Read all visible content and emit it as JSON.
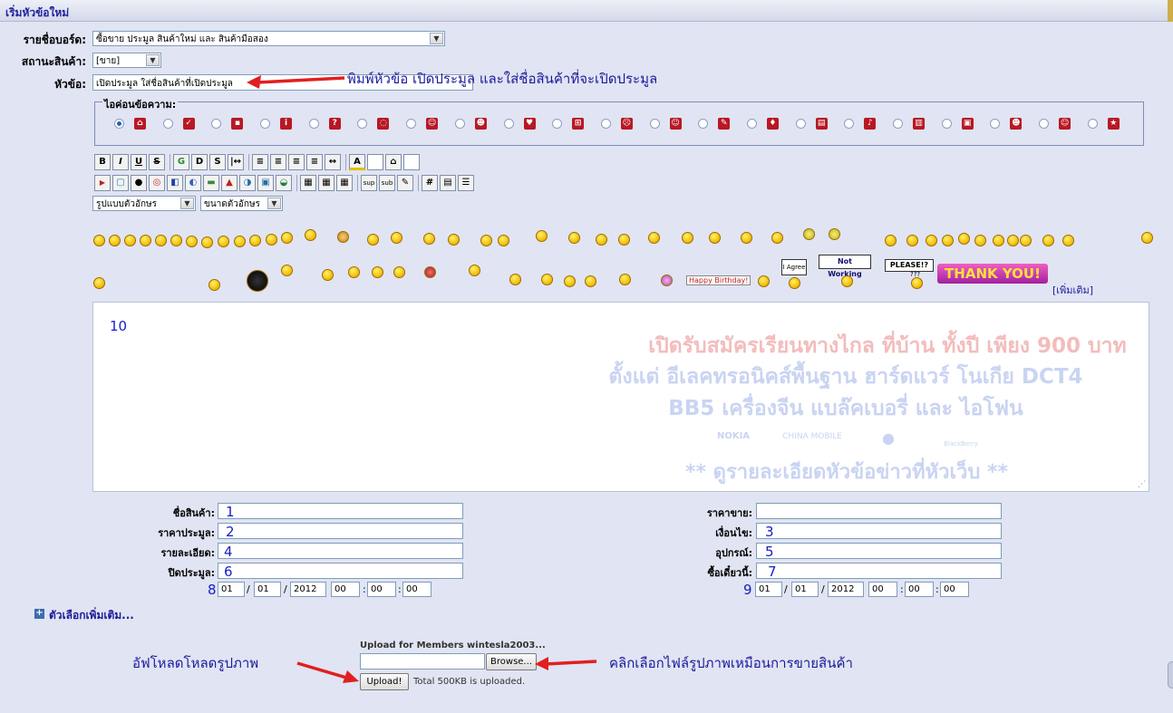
{
  "page": {
    "title": "เริ่มหัวข้อใหม่"
  },
  "form": {
    "board_label": "รายชื่อบอร์ด:",
    "board_value": "ซื้อขาย ประมูล สินค้าใหม่ และ สินค้ามือสอง",
    "status_label": "สถานะสินค้า:",
    "status_value": "[ขาย]",
    "subject_label": "หัวข้อ:",
    "subject_value": "เปิดประมูล ใส่ชื่อสินค้าที่เปิดประมูล",
    "icon_legend": "ไอค่อนข้อความ:",
    "font_select": "รูปแบบตัวอักษร",
    "size_select": "ขนาดตัวอักษร",
    "more_smileys": "[เพิ่มเติม]"
  },
  "annotations": {
    "subject_note": "พิมพ์หัวข้อ เปิดประมูล และใส่ชื่อสินค้าที่จะเปิดประมูล",
    "upload_note": "อัฟโหลดโหลดรูปภาพ",
    "browse_note": "คลิกเลือกไฟล์รูปภาพเหมือนการขายสินค้า"
  },
  "toolbar": {
    "row1": [
      "B",
      "I",
      "U",
      "S",
      "G",
      "D",
      "S",
      "|↔",
      "≡",
      "≡",
      "≡",
      "≡",
      "↔",
      "A",
      "",
      "⌂",
      ""
    ],
    "row2": [
      "▶",
      "▢",
      "●",
      "◎",
      "◧",
      "◐",
      "▬",
      "▲",
      "◑",
      "▣",
      "◒",
      "▦",
      "▦",
      "▦",
      "sup",
      "sub",
      "✎",
      "#",
      "▤",
      "☰"
    ]
  },
  "editor": {
    "content": "10",
    "promo_line1": "เปิดรับสมัครเรียนทางไกล ที่บ้าน ทั้งปี เพียง 900 บาท",
    "promo_line2": "ตั้งแต่ อีเลคทรอนิคส์พื้นฐาน ฮาร์ดแวร์ โนเกีย DCT4",
    "promo_line3": "BB5 เครื่องจีน  แบล๊คเบอรี่ และ ไอโฟน",
    "promo_brands": [
      "NOKIA",
      "CHINA MOBILE",
      "",
      "BlackBerry"
    ],
    "promo_line4": "** ดูรายละเอียดหัวข้อข่าวที่หัวเว็บ **"
  },
  "banners": {
    "happy_birthday": "Happy Birthday!",
    "i_agree": "I Agree",
    "not_working": "Not Working",
    "please": "PLEASE!?",
    "please_sub": "???",
    "thank_you": "THANK YOU!"
  },
  "fields": {
    "product_name_label": "ชื่อสินค้า:",
    "product_name_value": "1",
    "start_price_label": "ราคาประมูล:",
    "start_price_value": "2",
    "detail_label": "รายละเอียด:",
    "detail_value": "4",
    "close_label": "ปิดประมูล:",
    "close_value": "6",
    "sell_price_label": "ราคาขาย:",
    "condition_label": "เงื่อนไข:",
    "condition_value": "3",
    "equipment_label": "อุปกรณ์:",
    "equipment_value": "5",
    "buy_now_label": "ซื้อเดี๋ยวนี้:",
    "buy_now_value": "7",
    "date1_num": "8",
    "date2_num": "9",
    "date_parts": [
      "01",
      "01",
      "2012",
      "00",
      "00",
      "00"
    ],
    "date_seps": [
      "/",
      "/",
      "",
      ":",
      ":"
    ]
  },
  "more_options": "ตัวเลือกเพิ่มเติม...",
  "upload": {
    "title": "Upload for Members wintesla2003...",
    "browse": "Browse...",
    "upload_btn": "Upload!",
    "status": "Total 500KB is uploaded."
  },
  "colors": {
    "page_bg": "#e1e4f2",
    "title_text": "#22229c",
    "annotation": "#1a1a9c",
    "arrow": "#e02020"
  }
}
